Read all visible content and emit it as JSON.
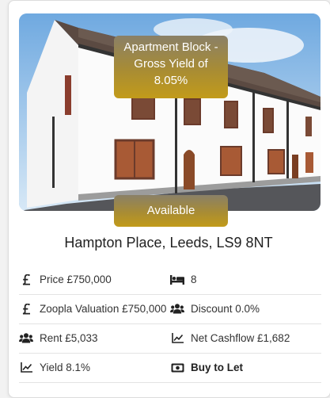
{
  "listing": {
    "type_badge": [
      "Apartment Block -",
      "Gross Yield of",
      "8.05%"
    ],
    "status_badge": "Available",
    "title": "Hampton Place, Leeds, LS9 8NT"
  },
  "details": [
    {
      "left": {
        "icon": "pound-icon",
        "text": "Price £750,000"
      },
      "right": {
        "icon": "bed-icon",
        "text": "8"
      }
    },
    {
      "left": {
        "icon": "pound-icon",
        "text": "Zoopla Valuation £750,000"
      },
      "right": {
        "icon": "users-icon",
        "text": "Discount 0.0%"
      }
    },
    {
      "left": {
        "icon": "users-icon",
        "text": "Rent £5,033"
      },
      "right": {
        "icon": "chart-line-icon",
        "text": "Net Cashflow £1,682"
      }
    },
    {
      "left": {
        "icon": "chart-line-icon",
        "text": "Yield 8.1%"
      },
      "right": {
        "icon": "money-bill-icon",
        "text": "Buy to Let"
      }
    }
  ],
  "colors": {
    "badge_gold": "#b8931f",
    "card_bg": "#ffffff"
  }
}
